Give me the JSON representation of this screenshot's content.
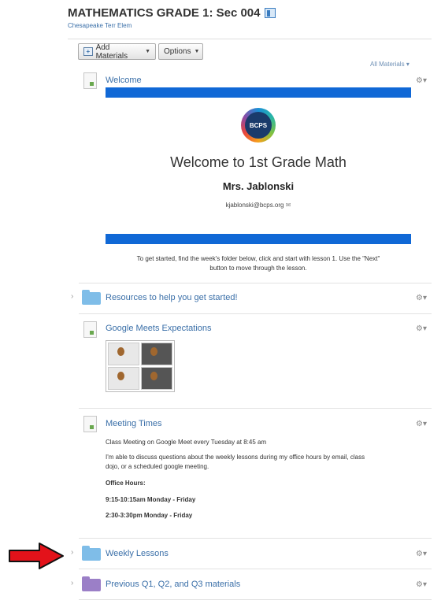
{
  "course": {
    "title": "MATHEMATICS GRADE 1: Sec 004",
    "school": "Chesapeake Terr Elem"
  },
  "toolbar": {
    "add_materials": "Add Materials",
    "options": "Options",
    "filter": "All Materials"
  },
  "welcome": {
    "title": "Welcome",
    "logo_text": "BCPS",
    "heading": "Welcome to 1st Grade Math",
    "teacher": "Mrs.  Jablonski",
    "email": "kjablonski@bcps.org",
    "instructions_1": "To get started, find the week's folder below, click and start with lesson 1.  Use the \"Next\"",
    "instructions_2": "button to move through the lesson."
  },
  "resources": {
    "title": "Resources to help you get started!"
  },
  "google_meets": {
    "title": "Google Meets Expectations"
  },
  "meeting_times": {
    "title": "Meeting Times",
    "line_1": "Class Meeting on Google Meet every Tuesday at 8:45 am",
    "line_2a": "I'm able to discuss questions about the weekly lessons during my office hours by email, class",
    "line_2b": "dojo, or a scheduled google meeting.",
    "office_hours_label": "Office Hours:",
    "hours_1": "9:15-10:15am Monday - Friday",
    "hours_2": "2:30-3:30pm Monday - Friday"
  },
  "weekly_lessons": {
    "title": "Weekly Lessons"
  },
  "previous": {
    "title": "Previous Q1, Q2, and Q3 materials"
  },
  "colors": {
    "link": "#3a6fa8",
    "banner": "#1068d6",
    "folder_blue": "#7fbde8",
    "folder_purple": "#9b7fc7",
    "arrow": "#e3121a"
  }
}
